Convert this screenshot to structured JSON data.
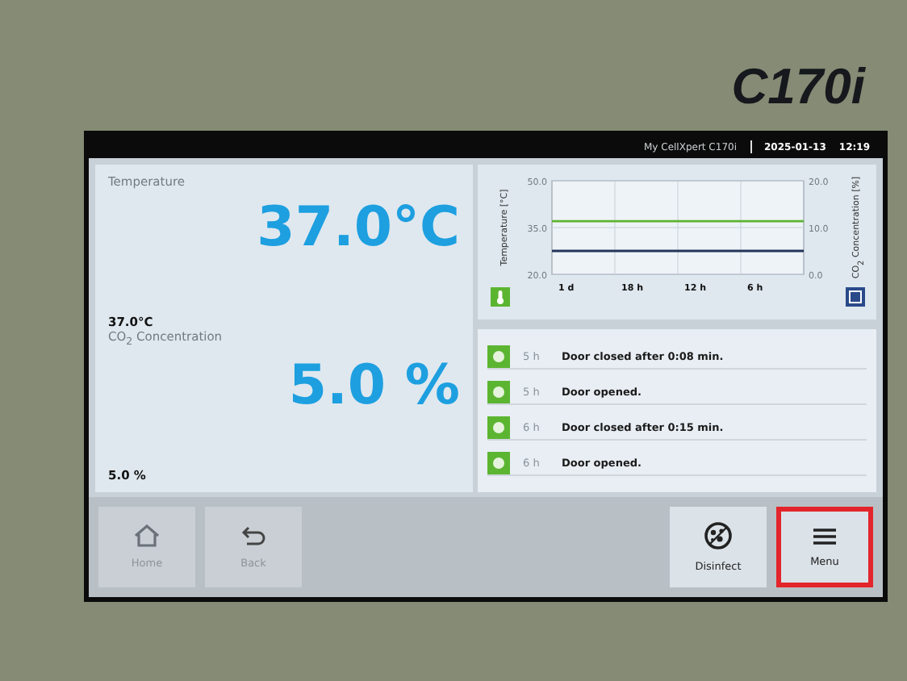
{
  "bezel": {
    "model": "C170i"
  },
  "header": {
    "device": "My CellXpert C170i",
    "date": "2025-01-13",
    "time": "12:19"
  },
  "readings": [
    {
      "label": "Temperature",
      "value": "37.0°C",
      "actual": "37.0°C"
    },
    {
      "label": "CO$_{2}$ Concentration",
      "value": "5.0 %",
      "actual": "5.0 %"
    }
  ],
  "chart": {
    "chart_data": {
      "type": "line",
      "categories": [
        "1 d",
        "18 h",
        "12 h",
        "6 h",
        null
      ],
      "ylabel": "Temperature [°C]",
      "ylim": [
        20,
        50
      ],
      "yticks": [
        {
          "value": 20,
          "label": "20.0"
        },
        {
          "value": 35,
          "label": "35.0"
        },
        {
          "value": 50,
          "label": "50.0"
        }
      ],
      "y2label": "CO$_{2}$ Concentration [%]",
      "y2lim": [
        0,
        20
      ],
      "y2ticks": [
        {
          "value": 0,
          "label": "0.0"
        },
        {
          "value": 10,
          "label": "10.0"
        },
        {
          "value": 20,
          "label": "20.0"
        }
      ],
      "series": [
        {
          "color": "#5cb531",
          "values": [
            37,
            37,
            37,
            37,
            37
          ]
        },
        {
          "color": "#22355a",
          "axis": "y2",
          "values": [
            5,
            5,
            5,
            5,
            5
          ]
        }
      ]
    }
  },
  "events": [
    {
      "time": "5 h",
      "text": "Door closed after 0:08 min."
    },
    {
      "time": "5 h",
      "text": "Door opened."
    },
    {
      "time": "6 h",
      "text": "Door closed after 0:15 min."
    },
    {
      "time": "6 h",
      "text": "Door opened."
    }
  ],
  "buttons": [
    {
      "kind": "home",
      "label": "Home",
      "disabled": true,
      "highlighted": false
    },
    {
      "kind": "back",
      "label": "Back",
      "disabled": true,
      "highlighted": false
    },
    {
      "kind": "disinfect",
      "label": "Disinfect",
      "disabled": false,
      "highlighted": false
    },
    {
      "kind": "menu",
      "label": "Menu",
      "disabled": false,
      "highlighted": true
    }
  ]
}
